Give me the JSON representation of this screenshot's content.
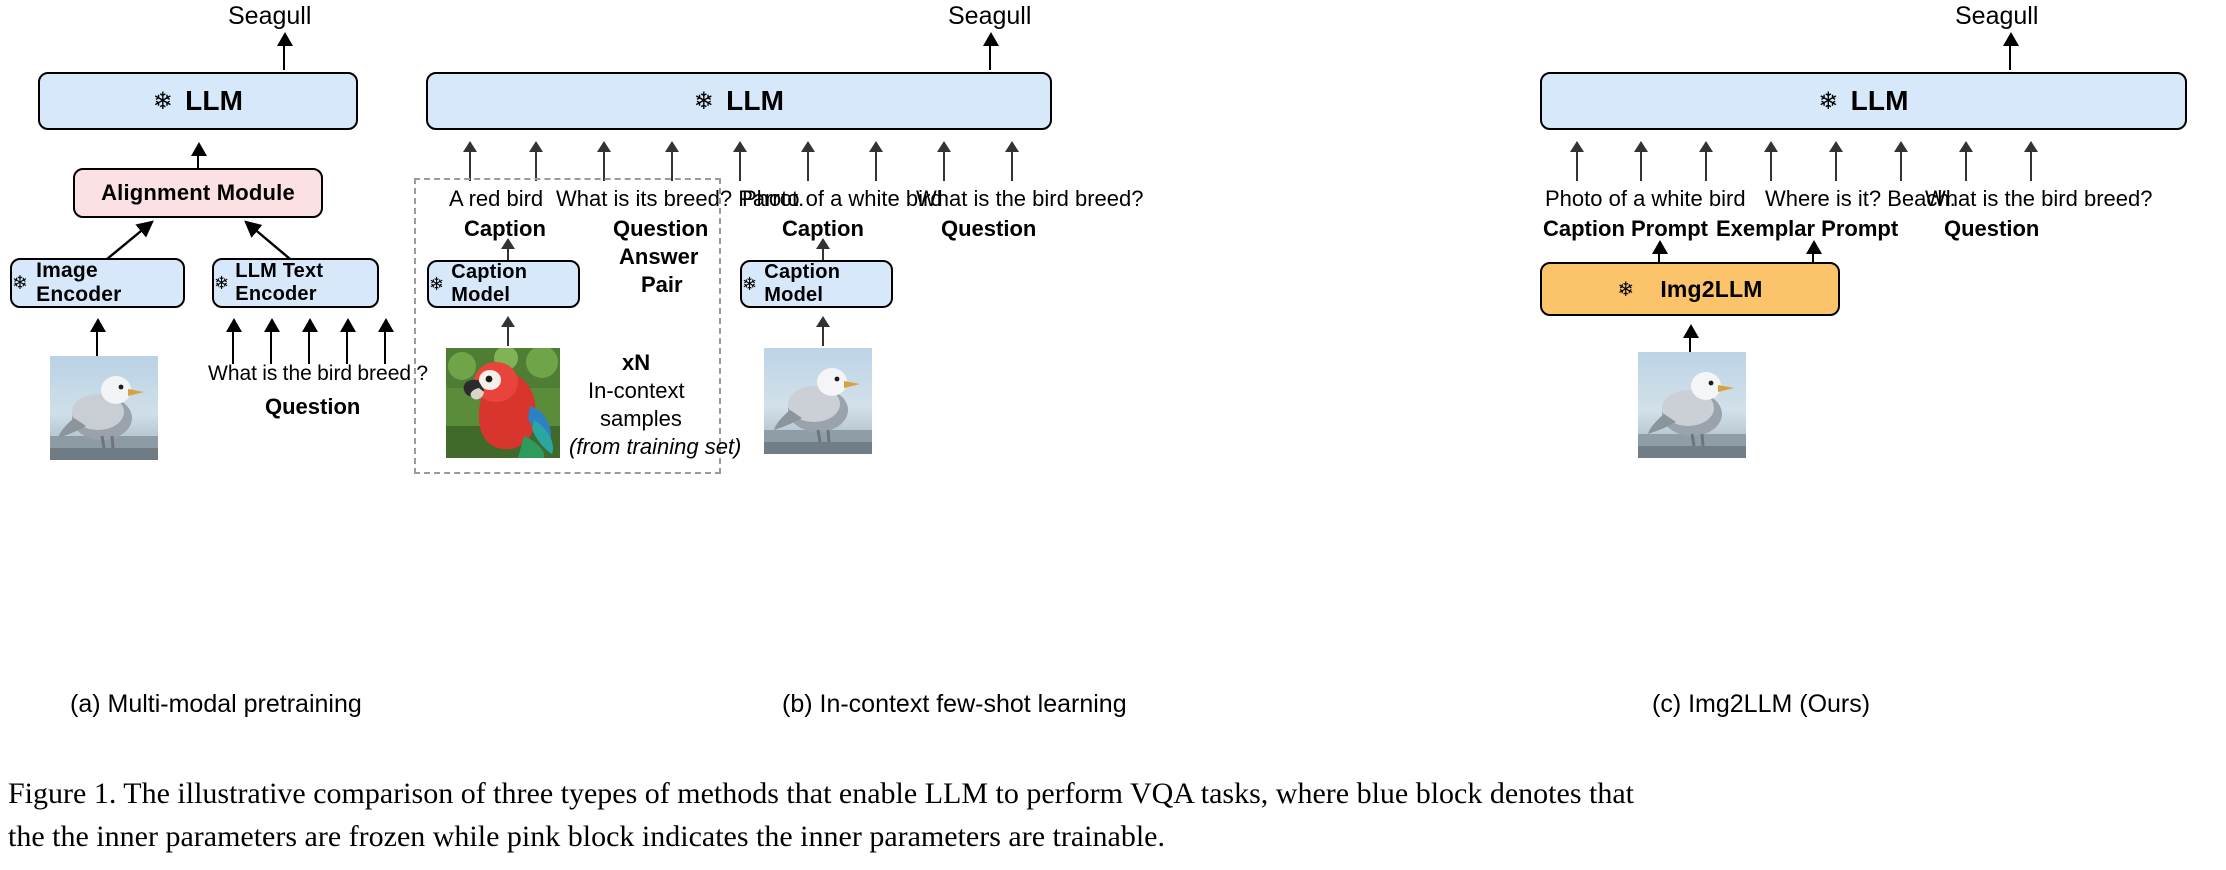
{
  "figure": {
    "caption_line1": "Figure 1.  The illustrative comparison of three tyepes of methods that enable LLM to perform VQA tasks, where blue block denotes that",
    "caption_line2": "the the inner parameters are frozen while pink block indicates the inner parameters are trainable."
  },
  "colors": {
    "blue_block": "#d6e8fa",
    "pink_block": "#fbe0e4",
    "orange_block": "#fbc46a",
    "outline": "#000000",
    "dashed_border": "#9a9a9a"
  },
  "icons": {
    "snowflake": "❄"
  },
  "panel_a": {
    "label": "(a)  Multi-modal pretraining",
    "output": "Seagull",
    "llm": "LLM",
    "alignment_module": "Alignment Module",
    "image_encoder": "Image Encoder",
    "text_encoder": "LLM Text Encoder",
    "question_words": [
      "What",
      "is",
      "the",
      "bird",
      "breed",
      "?"
    ],
    "question_label": "Question"
  },
  "panel_b": {
    "label": "(b) In-context few-shot learning",
    "output": "Seagull",
    "llm": "LLM",
    "exemplar_caption_text": "A red bird",
    "exemplar_caption_label": "Caption",
    "exemplar_qa_text": "What is its breed? Parrot.",
    "exemplar_qa_label_line1": "Question",
    "exemplar_qa_label_line2": "Answer",
    "exemplar_qa_label_line3": "Pair",
    "caption_model": "Caption Model",
    "repeat_count": "xN",
    "repeat_line1": "In-context",
    "repeat_line2": "samples",
    "repeat_line3": "(from training set)",
    "query_caption_text": "Photo of a white bird",
    "query_caption_label": "Caption",
    "query_caption_model": "Caption Model",
    "query_question_text": "What is the bird breed?",
    "query_question_label": "Question"
  },
  "panel_c": {
    "label": "(c) Img2LLM (Ours)",
    "output": "Seagull",
    "llm": "LLM",
    "caption_prompt_text": "Photo of a white bird",
    "caption_prompt_label": "Caption Prompt",
    "exemplar_prompt_text": "Where is it? Beach.",
    "exemplar_prompt_label": "Exemplar Prompt",
    "question_text": "What is the bird breed?",
    "question_label": "Question",
    "module": "Img2LLM"
  }
}
